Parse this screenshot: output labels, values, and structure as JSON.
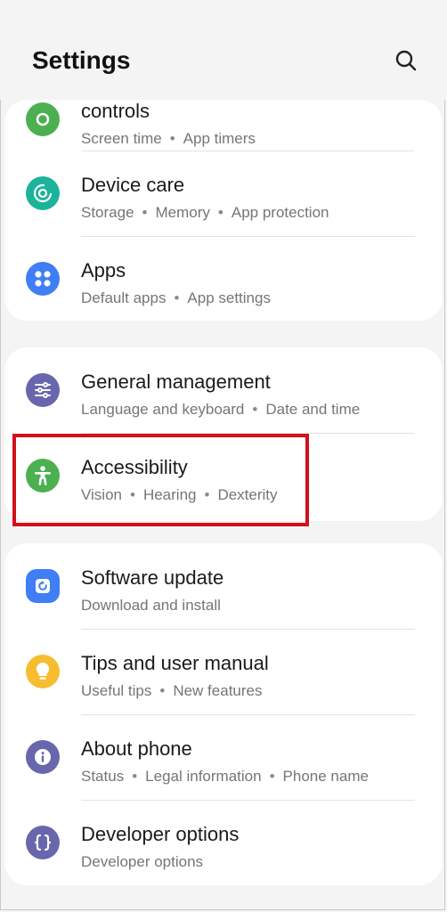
{
  "header": {
    "title": "Settings"
  },
  "colors": {
    "green": "#4caf50",
    "teal": "#1bb39a",
    "blue": "#3f7ef4",
    "purple": "#6866ac",
    "yellow": "#f6bd30",
    "highlight": "#d0121b"
  },
  "groups": [
    {
      "items": [
        {
          "title": "controls",
          "subtitle": [
            "Screen time",
            "App timers"
          ],
          "icon": "wellbeing-icon"
        },
        {
          "title": "Device care",
          "subtitle": [
            "Storage",
            "Memory",
            "App protection"
          ],
          "icon": "device-care-icon"
        },
        {
          "title": "Apps",
          "subtitle": [
            "Default apps",
            "App settings"
          ],
          "icon": "apps-icon"
        }
      ]
    },
    {
      "items": [
        {
          "title": "General management",
          "subtitle": [
            "Language and keyboard",
            "Date and time"
          ],
          "icon": "sliders-icon"
        },
        {
          "title": "Accessibility",
          "subtitle": [
            "Vision",
            "Hearing",
            "Dexterity"
          ],
          "icon": "accessibility-icon"
        }
      ]
    },
    {
      "items": [
        {
          "title": "Software update",
          "subtitle": [
            "Download and install"
          ],
          "icon": "update-icon"
        },
        {
          "title": "Tips and user manual",
          "subtitle": [
            "Useful tips",
            "New features"
          ],
          "icon": "lightbulb-icon"
        },
        {
          "title": "About phone",
          "subtitle": [
            "Status",
            "Legal information",
            "Phone name"
          ],
          "icon": "info-icon"
        },
        {
          "title": "Developer options",
          "subtitle": [
            "Developer options"
          ],
          "icon": "braces-icon"
        }
      ]
    }
  ]
}
